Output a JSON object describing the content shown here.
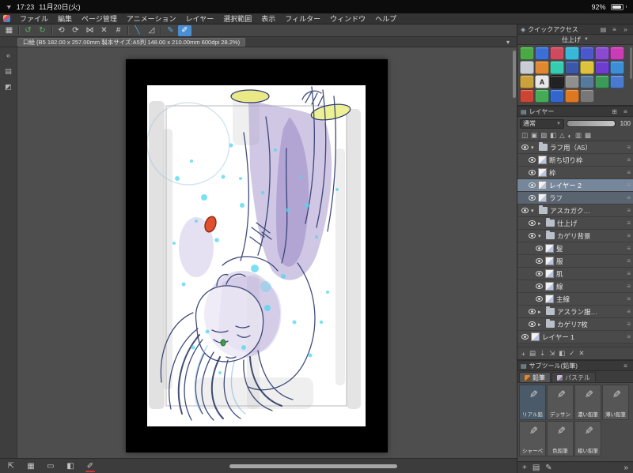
{
  "status_bar": {
    "time": "17:23",
    "date": "11月20日(火)",
    "battery_percent": "92%"
  },
  "menu_bar": {
    "items": [
      {
        "name": "menu-file",
        "label": "ファイル"
      },
      {
        "name": "menu-edit",
        "label": "編集"
      },
      {
        "name": "menu-page-manage",
        "label": "ページ管理"
      },
      {
        "name": "menu-animation",
        "label": "アニメーション"
      },
      {
        "name": "menu-layer",
        "label": "レイヤー"
      },
      {
        "name": "menu-selection",
        "label": "選択範囲"
      },
      {
        "name": "menu-view",
        "label": "表示"
      },
      {
        "name": "menu-filter",
        "label": "フィルター"
      },
      {
        "name": "menu-window",
        "label": "ウィンドウ"
      },
      {
        "name": "menu-help",
        "label": "ヘルプ"
      }
    ]
  },
  "toolbar": {
    "icons": [
      {
        "name": "transform-grid-icon",
        "glyph": "▦"
      },
      {
        "name": "separator-1",
        "sep": true
      },
      {
        "name": "undo-icon",
        "glyph": "↺",
        "color": "#5cb85c"
      },
      {
        "name": "redo-icon",
        "glyph": "↻",
        "color": "#5cb85c"
      },
      {
        "name": "separator-2",
        "sep": true
      },
      {
        "name": "rotate-ccw-icon",
        "glyph": "⟲"
      },
      {
        "name": "rotate-cw-icon",
        "glyph": "⟳"
      },
      {
        "name": "flip-horizontal-icon",
        "glyph": "⋈"
      },
      {
        "name": "symmetry-ruler-icon",
        "glyph": "✕"
      },
      {
        "name": "grid-snap-icon",
        "glyph": "#"
      },
      {
        "name": "separator-3",
        "sep": true
      },
      {
        "name": "snap-line-icon",
        "glyph": "╲",
        "color": "#57a8e2"
      },
      {
        "name": "snap-perspective-icon",
        "glyph": "◿"
      },
      {
        "name": "separator-4",
        "sep": true
      },
      {
        "name": "stylus-pressure-icon",
        "glyph": "✎",
        "color": "#57a8e2"
      },
      {
        "name": "touch-gesture-icon",
        "glyph": "✐",
        "active": true
      }
    ]
  },
  "tab_bar": {
    "document_title": "口絵 (B5 182.00 x 257.00mm 製本サイズ:A5判 148.00 x 210.00mm 600dpi 28.2%)"
  },
  "left_strip": {
    "icons": [
      {
        "name": "collapse-left-palette-icon",
        "glyph": "«"
      },
      {
        "name": "tool-palette-icon",
        "glyph": "▤"
      },
      {
        "name": "color-palette-icon",
        "glyph": "◩"
      }
    ]
  },
  "quick_access": {
    "title": "クイックアクセス",
    "set_name": "仕上げ",
    "items": [
      {
        "color": "#4aa845"
      },
      {
        "color": "#3b6fd6"
      },
      {
        "color": "#d04a5f"
      },
      {
        "color": "#38b8d8"
      },
      {
        "color": "#4a58cc"
      },
      {
        "color": "#8a4ad0"
      },
      {
        "color": "#c93cb4"
      },
      {
        "color": "#c8ccd4"
      },
      {
        "color": "#e08830"
      },
      {
        "color": "#35cdb2"
      },
      {
        "color": "#3b57a8"
      },
      {
        "color": "#ddc33c"
      },
      {
        "color": "#6f3cd0"
      },
      {
        "color": "#3c8fd6"
      },
      {
        "color": "#caa23c"
      },
      {
        "color": "#e8e8e8",
        "glyph": "A"
      },
      {
        "color": "#222222"
      },
      {
        "color": "#909090"
      },
      {
        "color": "#567a9a"
      },
      {
        "color": "#3c9a58"
      },
      {
        "color": "#4a7ad0"
      },
      {
        "color": "#cc4433"
      },
      {
        "color": "#44aa55"
      },
      {
        "color": "#3366cc"
      },
      {
        "color": "#dd7722"
      },
      {
        "color": "#777777"
      }
    ]
  },
  "layer_panel": {
    "title": "レイヤー",
    "blend_mode": "通常",
    "opacity": "100",
    "command_icons": [
      {
        "name": "clip-at-layer-icon",
        "glyph": "◫"
      },
      {
        "name": "lock-layer-icon",
        "glyph": "▣"
      },
      {
        "name": "lock-alpha-icon",
        "glyph": "▨"
      },
      {
        "name": "mask-icon",
        "glyph": "◧"
      },
      {
        "name": "ruler-icon",
        "glyph": "△"
      },
      {
        "name": "reference-layer-icon",
        "glyph": "◐"
      },
      {
        "name": "onion-skin-icon",
        "glyph": "▥"
      },
      {
        "name": "layer-color-icon",
        "glyph": "▩"
      }
    ],
    "layers": [
      {
        "name": "ラフ用（A5）",
        "indent": 0,
        "folder": true,
        "open": true
      },
      {
        "name": "断ち切り枠",
        "indent": 1
      },
      {
        "name": "枠",
        "indent": 1
      },
      {
        "name": "レイヤー 2",
        "indent": 1,
        "selected": true
      },
      {
        "name": "ラフ",
        "indent": 1,
        "hl": true
      },
      {
        "name": "アスカガク…",
        "indent": 0,
        "folder": true,
        "open": true
      },
      {
        "name": "仕上げ",
        "indent": 1,
        "folder": true
      },
      {
        "name": "カゲリ背景",
        "indent": 1,
        "folder": true,
        "open": true
      },
      {
        "name": "髪",
        "indent": 2
      },
      {
        "name": "服",
        "indent": 2
      },
      {
        "name": "肌",
        "indent": 2
      },
      {
        "name": "線",
        "indent": 2
      },
      {
        "name": "主線",
        "indent": 2
      },
      {
        "name": "アスラン服…",
        "indent": 1,
        "folder": true
      },
      {
        "name": "カゲリ7枚",
        "indent": 1,
        "folder": true
      },
      {
        "name": "レイヤー 1",
        "indent": 0
      }
    ],
    "bottom_icons": [
      {
        "name": "new-layer-icon",
        "glyph": "+"
      },
      {
        "name": "new-folder-icon",
        "glyph": "▤"
      },
      {
        "name": "transfer-down-icon",
        "glyph": "⇣"
      },
      {
        "name": "merge-down-icon",
        "glyph": "⇲"
      },
      {
        "name": "add-mask-icon",
        "glyph": "◧"
      },
      {
        "name": "apply-mask-icon",
        "glyph": "✓"
      },
      {
        "name": "delete-layer-icon",
        "glyph": "✕"
      }
    ]
  },
  "subtool_panel": {
    "title": "サブツール(鉛筆)",
    "tabs": [
      {
        "name": "subtool-tab-pencil",
        "label": "鉛筆",
        "active": true
      },
      {
        "name": "subtool-tab-pastel",
        "label": "パステル"
      }
    ],
    "tools": [
      {
        "name": "リアル鉛",
        "selected": true
      },
      {
        "name": "デッサン"
      },
      {
        "name": "濃い鉛筆"
      },
      {
        "name": "薄い鉛筆"
      },
      {
        "name": "シャーペ"
      },
      {
        "name": "色鉛筆"
      },
      {
        "name": "粗い鉛筆"
      }
    ]
  },
  "bottom_bar": {
    "icons": [
      {
        "name": "fullscreen-icon",
        "glyph": "⇱"
      },
      {
        "name": "command-bar-icon",
        "glyph": "▦"
      },
      {
        "name": "edge-keyboard-icon",
        "glyph": "▭"
      },
      {
        "name": "companion-view-icon",
        "glyph": "◧"
      },
      {
        "name": "current-brush-icon",
        "glyph": "✐",
        "underline": true
      }
    ]
  },
  "panel_bottom": {
    "icons": [
      {
        "name": "add-palette-icon",
        "glyph": "+"
      },
      {
        "name": "palette-dock-icon",
        "glyph": "▤"
      },
      {
        "name": "brush-settings-icon",
        "glyph": "✎"
      }
    ],
    "collapse_icon": "»"
  }
}
